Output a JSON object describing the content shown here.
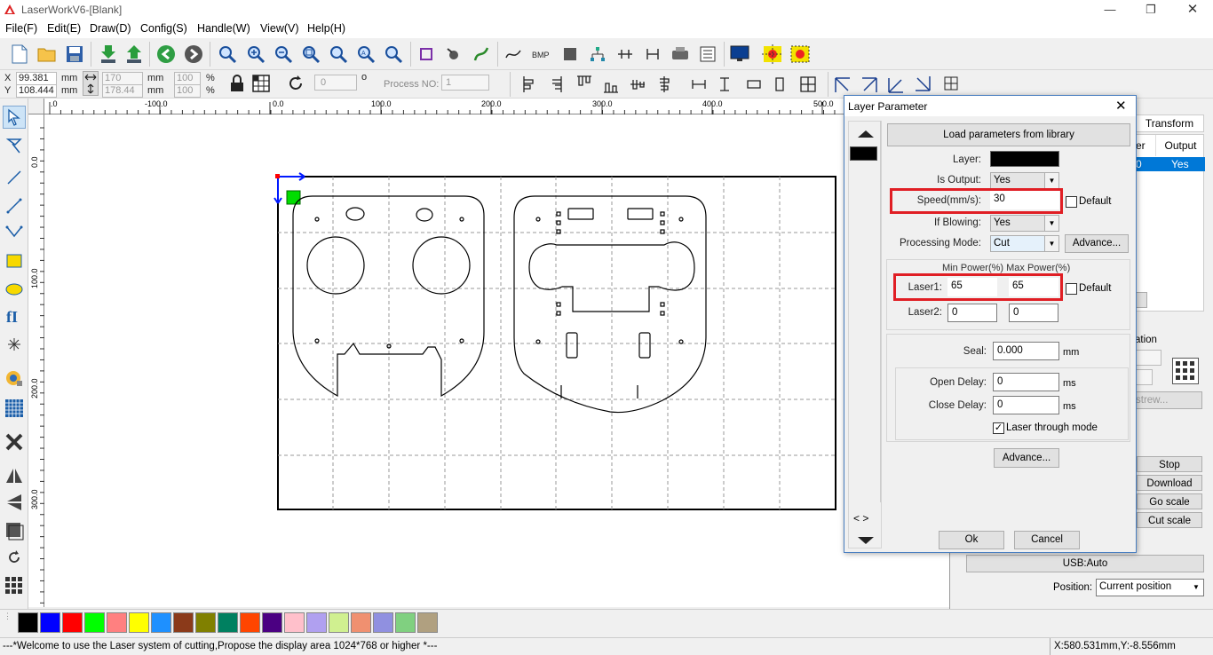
{
  "window": {
    "title": "LaserWorkV6-[Blank]"
  },
  "menu": [
    "File(F)",
    "Edit(E)",
    "Draw(D)",
    "Config(S)",
    "Handle(W)",
    "View(V)",
    "Help(H)"
  ],
  "coords": {
    "x_label": "X",
    "x_value": "99.381",
    "y_label": "Y",
    "y_value": "108.444",
    "unit": "mm",
    "width": "170",
    "height": "178.44",
    "scale_x": "100",
    "scale_y": "100",
    "percent": "%",
    "rotation": "0",
    "degree": "o",
    "process_label": "Process NO:",
    "process_value": "1"
  },
  "ruler_top": [
    "-100.0",
    "0.0",
    "100.0",
    "200.0",
    "300.0",
    "400.0",
    "500.0"
  ],
  "ruler_left": [
    "100.0",
    "200.0",
    "300.0"
  ],
  "palette": [
    "#000000",
    "#0000ff",
    "#ff0000",
    "#00ff00",
    "#ff8080",
    "#ffff00",
    "#1e90ff",
    "#8b3a1a",
    "#808000",
    "#008060",
    "#ff4500",
    "#4b0082",
    "#ffc0cb",
    "#b0a0f0",
    "#d0f090",
    "#f09070",
    "#9090e0",
    "#80d080",
    "#b0a080"
  ],
  "status": {
    "message": "---*Welcome to use the Laser system of cutting,Propose the display area 1024*768 or higher *---",
    "position": "X:580.531mm,Y:-8.556mm"
  },
  "right_panel": {
    "tab_transform": "Transform",
    "col_layer_partial": "er",
    "col_output": "Output",
    "row_layer_partial": "0",
    "row_output": "Yes",
    "location_partial": "ation",
    "strew_partial": "strew...",
    "stop": "Stop",
    "download": "Download",
    "go_scale": "Go scale",
    "cut_scale": "Cut scale",
    "usb": "USB:Auto",
    "position_label": "Position:",
    "position_value": "Current position"
  },
  "dialog": {
    "title": "Layer Parameter",
    "load_btn": "Load parameters from library",
    "layer_label": "Layer:",
    "is_output_label": "Is Output:",
    "is_output_value": "Yes",
    "speed_label": "Speed(mm/s):",
    "speed_value": "30",
    "default_label": "Default",
    "blowing_label": "If Blowing:",
    "blowing_value": "Yes",
    "mode_label": "Processing Mode:",
    "mode_value": "Cut",
    "advance_btn": "Advance...",
    "power_header": "Min Power(%) Max Power(%)",
    "laser1_label": "Laser1:",
    "laser1_min": "65",
    "laser1_max": "65",
    "laser2_label": "Laser2:",
    "laser2_min": "0",
    "laser2_max": "0",
    "seal_label": "Seal:",
    "seal_value": "0.000",
    "mm": "mm",
    "open_delay_label": "Open Delay:",
    "open_delay_value": "0",
    "close_delay_label": "Close Delay:",
    "close_delay_value": "0",
    "ms": "ms",
    "through_mode_label": "Laser through mode",
    "advance2_btn": "Advance...",
    "ok": "Ok",
    "cancel": "Cancel",
    "nav": "< >"
  }
}
